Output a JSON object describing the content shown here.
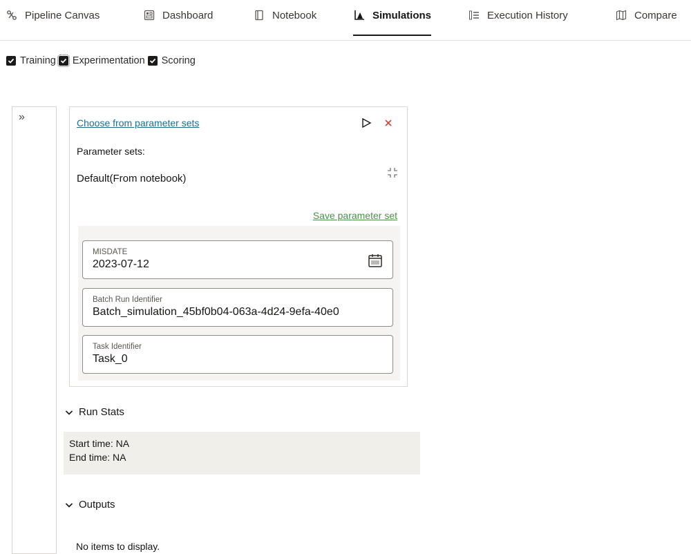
{
  "tabs": [
    {
      "label": "Pipeline Canvas",
      "icon": "pipeline-icon"
    },
    {
      "label": "Dashboard",
      "icon": "dashboard-icon"
    },
    {
      "label": "Notebook",
      "icon": "notebook-icon"
    },
    {
      "label": "Simulations",
      "icon": "chart-icon",
      "active": true
    },
    {
      "label": "Execution History",
      "icon": "list-icon"
    },
    {
      "label": "Compare",
      "icon": "map-icon"
    }
  ],
  "filters": [
    {
      "label": "Training",
      "checked": true
    },
    {
      "label": "Experimentation",
      "checked": true
    },
    {
      "label": "Scoring",
      "checked": true
    }
  ],
  "panel": {
    "choose_link": "Choose from parameter sets",
    "parameter_sets_label": "Parameter sets:",
    "parameter_set_value": "Default(From notebook)",
    "save_link": "Save parameter set",
    "fields": [
      {
        "label": "MISDATE",
        "value": "2023-07-12"
      },
      {
        "label": "Batch Run Identifier",
        "value": "Batch_simulation_45bf0b04-063a-4d24-9efa-40e0"
      },
      {
        "label": "Task Identifier",
        "value": "Task_0"
      }
    ]
  },
  "run_stats": {
    "title": "Run Stats",
    "start": "Start time: NA",
    "end": "End time: NA"
  },
  "outputs": {
    "title": "Outputs",
    "empty": "No items to display."
  },
  "colors": {
    "link": "#1b6d90",
    "save_link": "#4e8f49",
    "close": "#c74634"
  }
}
